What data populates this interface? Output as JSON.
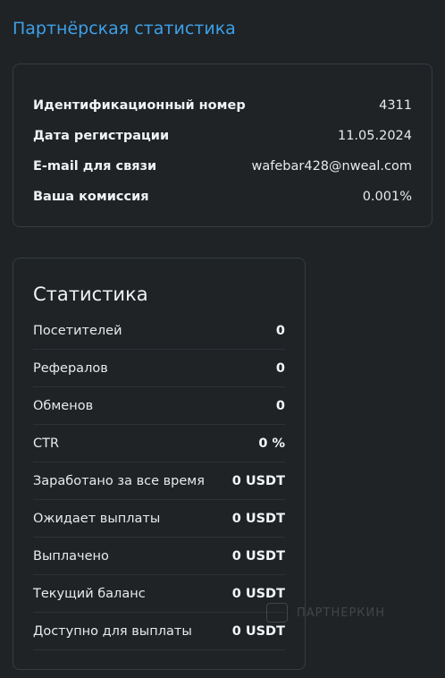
{
  "page": {
    "title": "Партнёрская статистика"
  },
  "info": {
    "rows": [
      {
        "label": "Идентификационный номер",
        "value": "4311"
      },
      {
        "label": "Дата регистрации",
        "value": "11.05.2024"
      },
      {
        "label": "E-mail для связи",
        "value": "wafebar428@nweal.com"
      },
      {
        "label": "Ваша комиссия",
        "value": "0.001%"
      }
    ]
  },
  "stats": {
    "title": "Статистика",
    "rows": [
      {
        "label": "Посетителей",
        "value": "0"
      },
      {
        "label": "Рефералов",
        "value": "0"
      },
      {
        "label": "Обменов",
        "value": "0"
      },
      {
        "label": "CTR",
        "value": "0 %"
      },
      {
        "label": "Заработано за все время",
        "value": "0 USDT"
      },
      {
        "label": "Ожидает выплаты",
        "value": "0 USDT"
      },
      {
        "label": "Выплачено",
        "value": "0 USDT"
      },
      {
        "label": "Текущий баланс",
        "value": "0 USDT"
      },
      {
        "label": "Доступно для выплаты",
        "value": "0 USDT"
      }
    ]
  },
  "watermark": {
    "text": "ПАРТНЕРКИН"
  }
}
